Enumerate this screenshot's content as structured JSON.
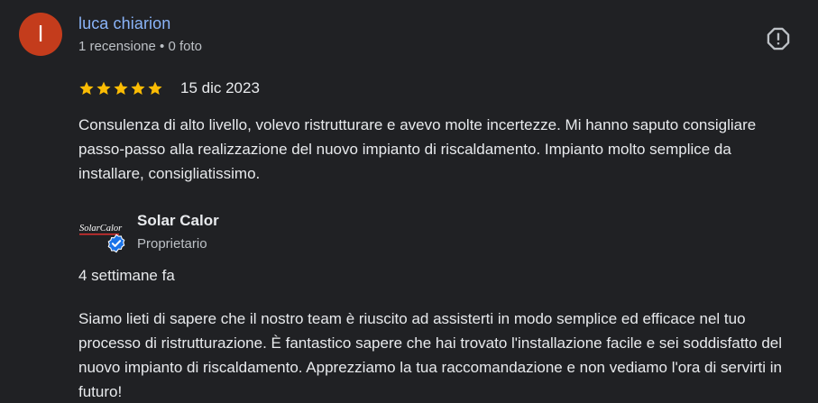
{
  "reviewer": {
    "avatar_initial": "l",
    "name": "luca chiarion",
    "meta": "1 recensione • 0 foto"
  },
  "review": {
    "rating": 5,
    "rating_max": 5,
    "date": "15 dic 2023",
    "text": "Consulenza di alto livello, volevo ristrutturare e avevo molte incertezze. Mi hanno saputo consigliare passo-passo alla realizzazione del nuovo impianto di riscaldamento. Impianto molto semplice da installare, consigliatissimo."
  },
  "owner_reply": {
    "logo_text": "SolarCalor",
    "name": "Solar Calor",
    "role": "Proprietario",
    "date": "4 settimane fa",
    "text": "Siamo lieti di sapere che il nostro team è riuscito ad assisterti in modo semplice ed efficace nel tuo processo di ristrutturazione. È fantastico sapere che hai trovato l'installazione facile e sei soddisfatto del nuovo impianto di riscaldamento. Apprezziamo la tua raccomandazione e non vediamo l'ora di servirti in futuro!"
  },
  "icons": {
    "report": "report-icon",
    "star": "star-icon",
    "verified": "verified-badge-icon"
  },
  "colors": {
    "background": "#202124",
    "name_link": "#8ab4f8",
    "avatar": "#c43c1c",
    "star": "#fbbc04",
    "verified": "#1a73e8"
  }
}
